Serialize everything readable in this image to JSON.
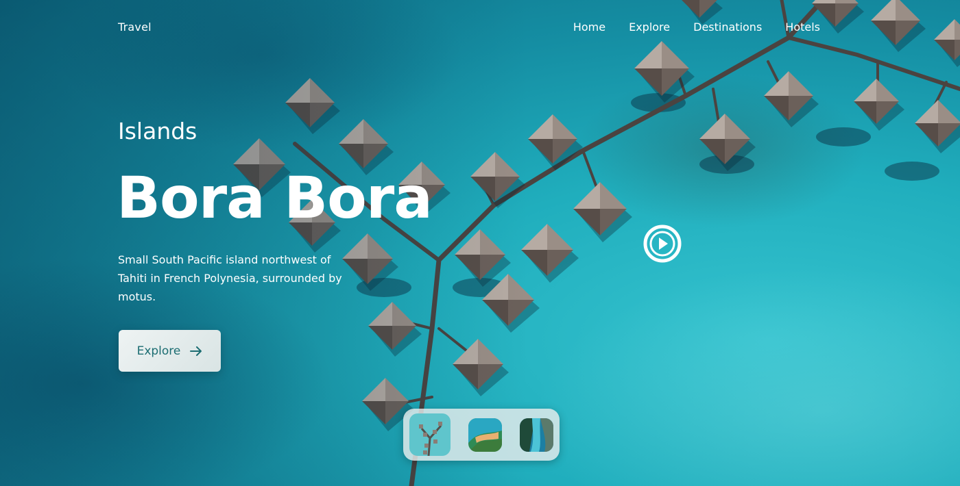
{
  "brand": "Travel",
  "nav": {
    "items": [
      "Home",
      "Explore",
      "Destinations",
      "Hotels"
    ]
  },
  "hero": {
    "eyebrow": "Islands",
    "title": "Bora Bora",
    "description": "Small South Pacific island northwest of Tahiti in French Polynesia, surrounded by motus.",
    "cta_label": "Explore"
  },
  "icons": {
    "cta": "arrow-right-icon",
    "video": "play-icon"
  },
  "colors": {
    "ocean": "#20aebd",
    "button_text": "#1c6d72",
    "button_bg": "#e6eded",
    "roof": "#7b6e66"
  },
  "thumbnails": [
    "overwater-bungalows",
    "island-beach",
    "lagoon-cliffs"
  ]
}
